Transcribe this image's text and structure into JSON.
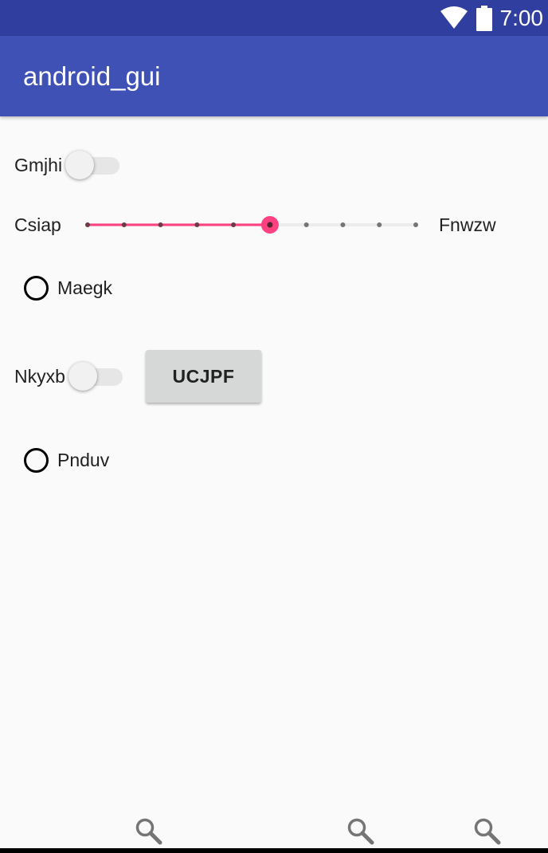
{
  "status_bar": {
    "time": "7:00",
    "icons": [
      "wifi-icon",
      "battery-icon"
    ],
    "background": "#303f9f"
  },
  "app_bar": {
    "title": "android_gui",
    "background": "#3f51b5"
  },
  "form": {
    "switch_1": {
      "label": "Gmjhi",
      "checked": false
    },
    "seekbar": {
      "left_label": "Csiap",
      "right_label": "Fnwzw",
      "steps": 10,
      "value": 5,
      "accent": "#ff4081"
    },
    "radio_1": {
      "label": "Maegk",
      "checked": false
    },
    "switch_2": {
      "label": "Nkyxb",
      "checked": false
    },
    "button": {
      "label": "UCJPF"
    },
    "radio_2": {
      "label": "Pnduv",
      "checked": false
    }
  },
  "bottom_icons": [
    "search-icon",
    "search-icon",
    "search-icon"
  ]
}
